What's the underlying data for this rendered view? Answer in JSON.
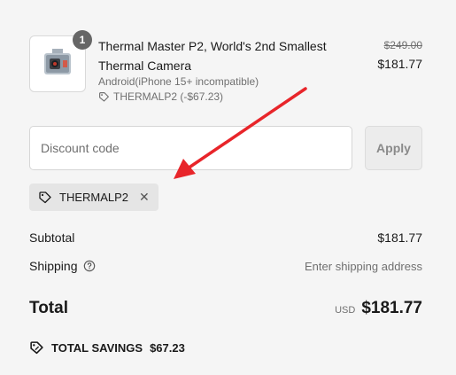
{
  "product": {
    "quantity": "1",
    "title": "Thermal Master P2, World's 2nd Smallest Thermal Camera",
    "variant": "Android(iPhone 15+ incompatible)",
    "discount_line": "THERMALP2 (-$67.23)",
    "original_price": "$249.00",
    "price": "$181.77"
  },
  "discount": {
    "placeholder": "Discount code",
    "apply_label": "Apply",
    "applied_code": "THERMALP2"
  },
  "summary": {
    "subtotal_label": "Subtotal",
    "subtotal_value": "$181.77",
    "shipping_label": "Shipping",
    "shipping_value": "Enter shipping address",
    "total_label": "Total",
    "currency": "USD",
    "total_value": "$181.77",
    "savings_label": "TOTAL SAVINGS",
    "savings_value": "$67.23"
  },
  "colors": {
    "background": "#f5f5f5",
    "arrow": "#e8252a",
    "muted_text": "#707070"
  }
}
